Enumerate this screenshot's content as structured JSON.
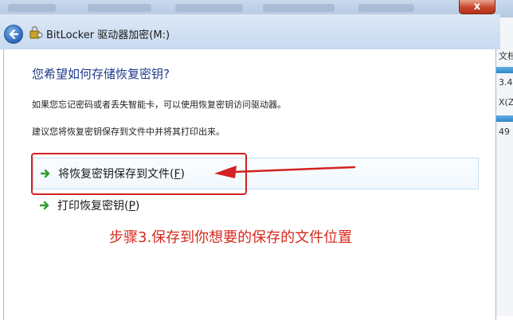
{
  "window": {
    "title": "BitLocker 驱动器加密(M:)",
    "close_label": "x"
  },
  "right_edge": {
    "fragments": [
      "文档",
      "3.4",
      "X(Z",
      "49"
    ]
  },
  "main": {
    "heading": "您希望如何存储恢复密钥?",
    "paragraph1": "如果您忘记密码或者丢失智能卡，可以使用恢复密钥访问驱动器。",
    "paragraph2": "建议您将恢复密钥保存到文件中并将其打印出来。",
    "options": [
      {
        "label": "将恢复密钥保存到文件",
        "accesskey": "F"
      },
      {
        "label": "打印恢复密钥",
        "accesskey": "P"
      }
    ]
  },
  "annotation": {
    "text": "步骤3.保存到你想要的保存的文件位置",
    "color": "#d62a1e"
  },
  "colors": {
    "heading": "#1e3a8a",
    "highlight_border": "#d32020",
    "option_arrow": "#2e9e2e"
  }
}
